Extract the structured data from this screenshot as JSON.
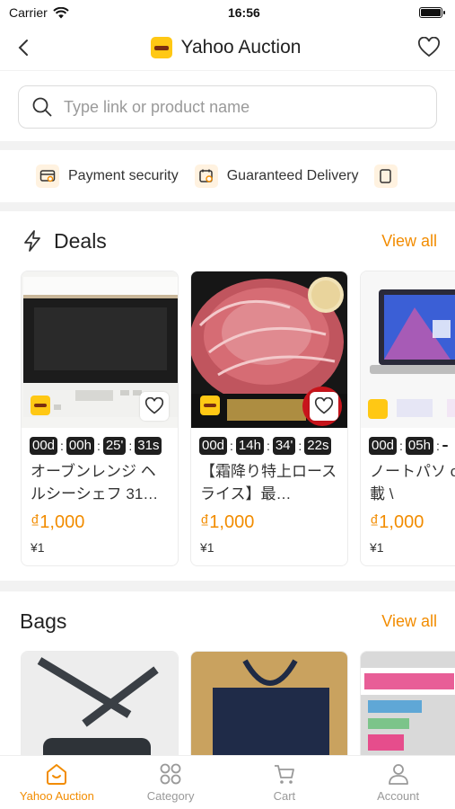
{
  "status_bar": {
    "carrier": "Carrier",
    "time": "16:56"
  },
  "header": {
    "title": "Yahoo Auction"
  },
  "search": {
    "placeholder": "Type link or product name"
  },
  "features": [
    {
      "label": "Payment security",
      "icon": "payment-security-icon"
    },
    {
      "label": "Guaranteed Delivery",
      "icon": "guaranteed-delivery-icon"
    }
  ],
  "deals": {
    "title": "Deals",
    "view_all": "View all",
    "items": [
      {
        "d": "00d",
        "h": "00h",
        "m": "25'",
        "s": "31s",
        "name": "オーブンレンジ ヘルシーシェフ 31…",
        "price": "₫1,000",
        "yen": "¥1"
      },
      {
        "d": "00d",
        "h": "14h",
        "m": "34'",
        "s": "22s",
        "name": "【霜降り特上ロースライス】最…",
        "price": "₫1,000",
        "yen": "¥1"
      },
      {
        "d": "00d",
        "h": "05h",
        "m": "",
        "s": "",
        "name": "ノートパソ office搭載 \\",
        "price": "₫1,000",
        "yen": "¥1"
      }
    ]
  },
  "bags": {
    "title": "Bags",
    "view_all": "View all"
  },
  "tabbar": {
    "items": [
      {
        "label": "Yahoo Auction",
        "icon": "home-icon",
        "active": true
      },
      {
        "label": "Category",
        "icon": "category-icon",
        "active": false
      },
      {
        "label": "Cart",
        "icon": "cart-icon",
        "active": false
      },
      {
        "label": "Account",
        "icon": "account-icon",
        "active": false
      }
    ]
  },
  "colors": {
    "accent": "#f28c00",
    "brand_yellow": "#ffc814"
  }
}
